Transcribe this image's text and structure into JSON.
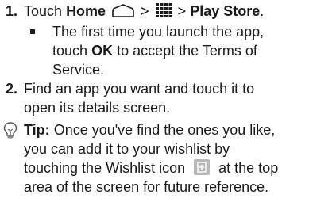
{
  "steps": [
    {
      "number": "1.",
      "parts": {
        "touch": "Touch",
        "home": "Home",
        "sep1": ">",
        "sep2": ">",
        "play_store": "Play Store",
        "end": "."
      },
      "subitem": {
        "line1": "The first time you launch the app,",
        "line2_pre": "touch",
        "ok": "OK",
        "line2_post": "to accept the Terms of",
        "line3": "Service."
      }
    },
    {
      "number": "2.",
      "line1": "Find an app you want and touch it to",
      "line2": "open its details screen."
    }
  ],
  "tip": {
    "label": "Tip:",
    "line1": "Once you've find the ones you like,",
    "line2": "you can add it to your wishlist by",
    "line3_pre": "touching the Wishlist icon",
    "line3_post": "at the top",
    "line4": "area of the screen for future reference.",
    "icons": [
      "lightbulb-icon",
      "wishlist-icon"
    ]
  },
  "icon_names": [
    "home-icon",
    "app-grid-icon",
    "square-bullet",
    "lightbulb-icon",
    "wishlist-icon"
  ]
}
